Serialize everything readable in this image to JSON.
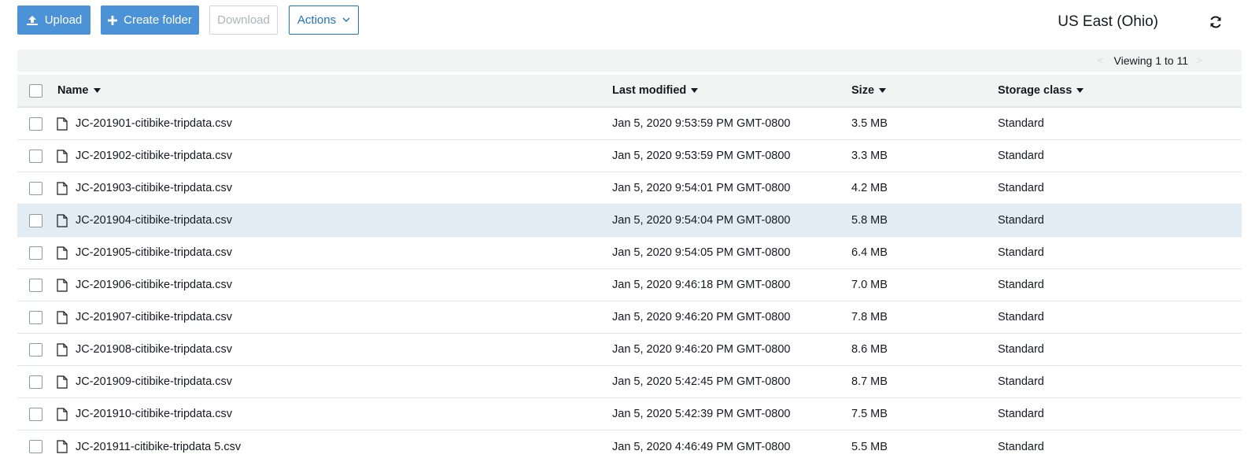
{
  "toolbar": {
    "upload_label": "Upload",
    "create_folder_label": "Create folder",
    "download_label": "Download",
    "actions_label": "Actions",
    "region": "US East (Ohio)"
  },
  "pager": {
    "viewing_text": "Viewing 1 to 11"
  },
  "table": {
    "columns": {
      "name": "Name",
      "last_modified": "Last modified",
      "size": "Size",
      "storage_class": "Storage class"
    },
    "rows": [
      {
        "name": "JC-201901-citibike-tripdata.csv",
        "last_modified": "Jan 5, 2020 9:53:59 PM GMT-0800",
        "size": "3.5 MB",
        "storage_class": "Standard"
      },
      {
        "name": "JC-201902-citibike-tripdata.csv",
        "last_modified": "Jan 5, 2020 9:53:59 PM GMT-0800",
        "size": "3.3 MB",
        "storage_class": "Standard"
      },
      {
        "name": "JC-201903-citibike-tripdata.csv",
        "last_modified": "Jan 5, 2020 9:54:01 PM GMT-0800",
        "size": "4.2 MB",
        "storage_class": "Standard"
      },
      {
        "name": "JC-201904-citibike-tripdata.csv",
        "last_modified": "Jan 5, 2020 9:54:04 PM GMT-0800",
        "size": "5.8 MB",
        "storage_class": "Standard",
        "highlighted": true
      },
      {
        "name": "JC-201905-citibike-tripdata.csv",
        "last_modified": "Jan 5, 2020 9:54:05 PM GMT-0800",
        "size": "6.4 MB",
        "storage_class": "Standard"
      },
      {
        "name": "JC-201906-citibike-tripdata.csv",
        "last_modified": "Jan 5, 2020 9:46:18 PM GMT-0800",
        "size": "7.0 MB",
        "storage_class": "Standard"
      },
      {
        "name": "JC-201907-citibike-tripdata.csv",
        "last_modified": "Jan 5, 2020 9:46:20 PM GMT-0800",
        "size": "7.8 MB",
        "storage_class": "Standard"
      },
      {
        "name": "JC-201908-citibike-tripdata.csv",
        "last_modified": "Jan 5, 2020 9:46:20 PM GMT-0800",
        "size": "8.6 MB",
        "storage_class": "Standard"
      },
      {
        "name": "JC-201909-citibike-tripdata.csv",
        "last_modified": "Jan 5, 2020 5:42:45 PM GMT-0800",
        "size": "8.7 MB",
        "storage_class": "Standard"
      },
      {
        "name": "JC-201910-citibike-tripdata.csv",
        "last_modified": "Jan 5, 2020 5:42:39 PM GMT-0800",
        "size": "7.5 MB",
        "storage_class": "Standard"
      },
      {
        "name": "JC-201911-citibike-tripdata 5.csv",
        "last_modified": "Jan 5, 2020 4:46:49 PM GMT-0800",
        "size": "5.5 MB",
        "storage_class": "Standard"
      }
    ]
  },
  "icons": {
    "upload": "upload-icon",
    "create_folder": "plus-icon",
    "actions_caret": "chevron-down-icon",
    "refresh": "refresh-icon",
    "file": "file-icon",
    "sort": "sort-caret-icon"
  },
  "colors": {
    "primary": "#4b93d6",
    "link": "#1f73bb",
    "header_bg": "#f2f3f3",
    "selected_row_bg": "#e1ecf5"
  }
}
